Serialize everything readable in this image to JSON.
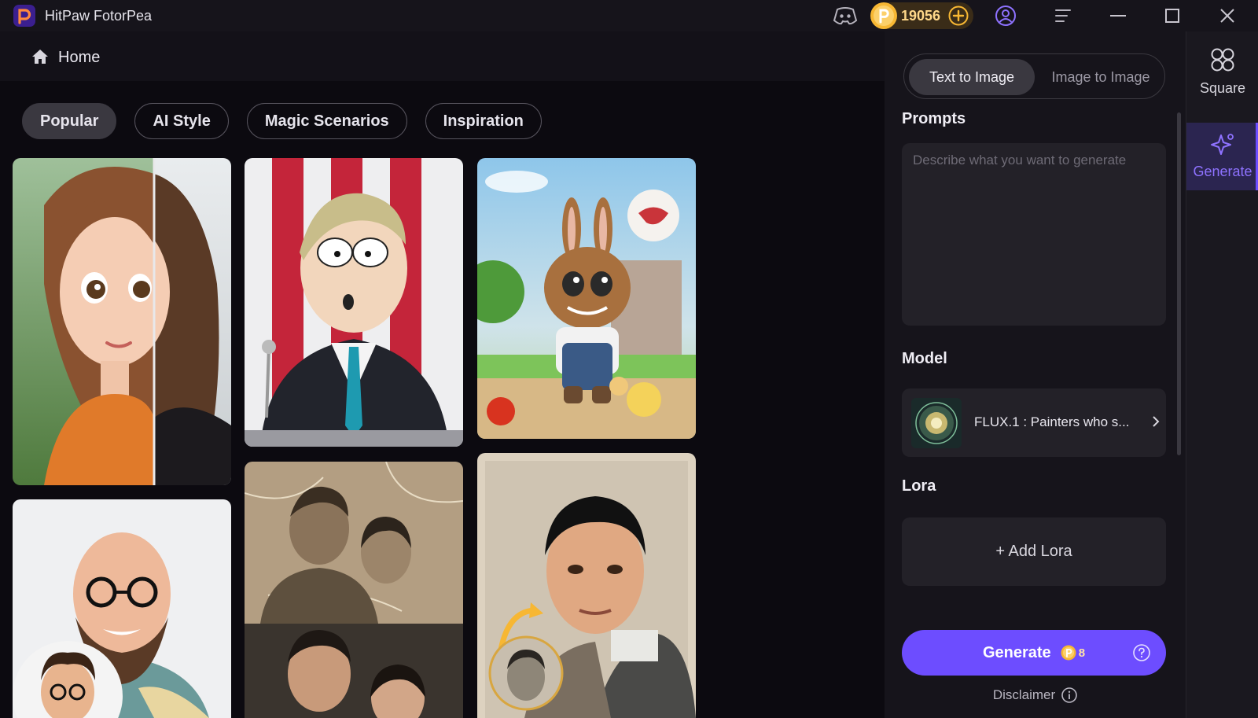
{
  "app": {
    "title": "HitPaw FotorPea"
  },
  "titlebar": {
    "coins": "19056",
    "icons": [
      "discord-icon",
      "coin-icon",
      "add-coins-icon",
      "account-icon",
      "menu-icon",
      "minimize-icon",
      "maximize-icon",
      "close-icon"
    ]
  },
  "nav": {
    "home_label": "Home"
  },
  "tabs": [
    {
      "label": "Popular",
      "active": true
    },
    {
      "label": "AI Style",
      "active": false
    },
    {
      "label": "Magic Scenarios",
      "active": false
    },
    {
      "label": "Inspiration",
      "active": false
    }
  ],
  "gallery": [
    {
      "name": "anime-girl-portrait"
    },
    {
      "name": "cartoon-politician-portrait"
    },
    {
      "name": "plush-bunny-toy"
    },
    {
      "name": "bald-man-portrait"
    },
    {
      "name": "old-couple-photo-restore"
    },
    {
      "name": "old-man-photo-colorize"
    }
  ],
  "panel": {
    "mode_active": "Text to Image",
    "mode_inactive": "Image to Image",
    "prompts_label": "Prompts",
    "prompt_placeholder": "Describe what you want to generate",
    "model_label": "Model",
    "model_name": "FLUX.1 : Painters who s...",
    "lora_label": "Lora",
    "add_lora": "+ Add Lora",
    "generate_label": "Generate",
    "generate_cost": "8",
    "disclaimer": "Disclaimer"
  },
  "rail": {
    "square_label": "Square",
    "generate_label": "Generate"
  },
  "colors": {
    "accent": "#6d4dff",
    "coin": "#f7b733"
  }
}
